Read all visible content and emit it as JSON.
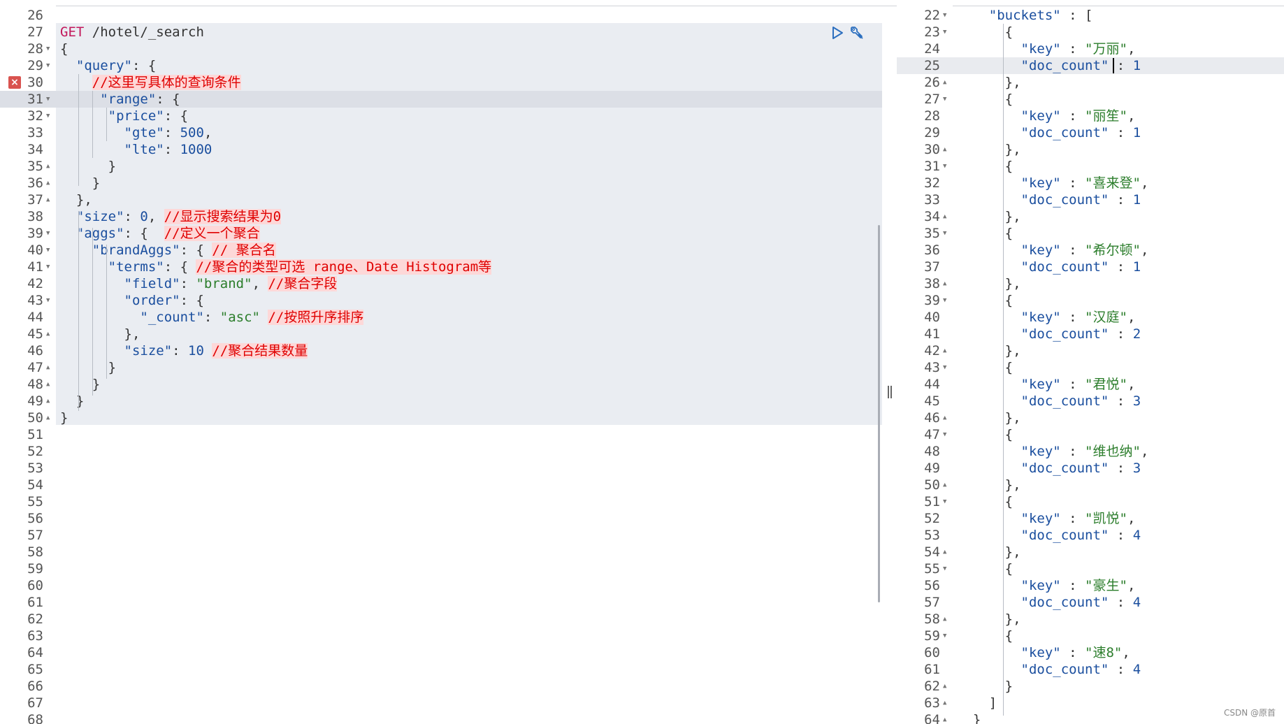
{
  "request_pane": {
    "error_line": "30",
    "lines": [
      {
        "n": "26",
        "fold": "",
        "code": []
      },
      {
        "n": "27",
        "fold": "",
        "code": [
          [
            "m",
            "GET"
          ],
          [
            "p",
            " /hotel/_search"
          ]
        ]
      },
      {
        "n": "28",
        "fold": "▼",
        "code": [
          [
            "p",
            "{"
          ]
        ]
      },
      {
        "n": "29",
        "fold": "▼",
        "code": [
          [
            "p",
            "  "
          ],
          [
            "k",
            "\"query\""
          ],
          [
            "p",
            ": {"
          ]
        ]
      },
      {
        "n": "30",
        "fold": "",
        "code": [
          [
            "p",
            "    "
          ],
          [
            "c",
            "//这里写具体的查询条件"
          ]
        ]
      },
      {
        "n": "31",
        "fold": "▼",
        "code": [
          [
            "p",
            "     "
          ],
          [
            "k",
            "\"range\""
          ],
          [
            "p",
            ": {"
          ]
        ]
      },
      {
        "n": "32",
        "fold": "▼",
        "code": [
          [
            "p",
            "      "
          ],
          [
            "k",
            "\"price\""
          ],
          [
            "p",
            ": {"
          ]
        ]
      },
      {
        "n": "33",
        "fold": "",
        "code": [
          [
            "p",
            "        "
          ],
          [
            "k",
            "\"gte\""
          ],
          [
            "p",
            ": "
          ],
          [
            "n",
            "500"
          ],
          [
            "p",
            ","
          ]
        ]
      },
      {
        "n": "34",
        "fold": "",
        "code": [
          [
            "p",
            "        "
          ],
          [
            "k",
            "\"lte\""
          ],
          [
            "p",
            ": "
          ],
          [
            "n",
            "1000"
          ]
        ]
      },
      {
        "n": "35",
        "fold": "▲",
        "code": [
          [
            "p",
            "      }"
          ]
        ]
      },
      {
        "n": "36",
        "fold": "▲",
        "code": [
          [
            "p",
            "    }"
          ]
        ]
      },
      {
        "n": "37",
        "fold": "▲",
        "code": [
          [
            "p",
            "  },"
          ]
        ]
      },
      {
        "n": "38",
        "fold": "",
        "code": [
          [
            "p",
            "  "
          ],
          [
            "k",
            "\"size\""
          ],
          [
            "p",
            ": "
          ],
          [
            "n",
            "0"
          ],
          [
            "p",
            ", "
          ],
          [
            "c",
            "//显示搜索结果为0"
          ]
        ]
      },
      {
        "n": "39",
        "fold": "▼",
        "code": [
          [
            "p",
            "  "
          ],
          [
            "k",
            "\"aggs\""
          ],
          [
            "p",
            ": {  "
          ],
          [
            "c",
            "//定义一个聚合"
          ]
        ]
      },
      {
        "n": "40",
        "fold": "▼",
        "code": [
          [
            "p",
            "    "
          ],
          [
            "k",
            "\"brandAggs\""
          ],
          [
            "p",
            ": { "
          ],
          [
            "c",
            "// 聚合名"
          ]
        ]
      },
      {
        "n": "41",
        "fold": "▼",
        "code": [
          [
            "p",
            "      "
          ],
          [
            "k",
            "\"terms\""
          ],
          [
            "p",
            ": { "
          ],
          [
            "c",
            "//聚合的类型可选 range、Date Histogram等"
          ]
        ]
      },
      {
        "n": "42",
        "fold": "",
        "code": [
          [
            "p",
            "        "
          ],
          [
            "k",
            "\"field\""
          ],
          [
            "p",
            ": "
          ],
          [
            "s",
            "\"brand\""
          ],
          [
            "p",
            ", "
          ],
          [
            "c",
            "//聚合字段"
          ]
        ]
      },
      {
        "n": "43",
        "fold": "▼",
        "code": [
          [
            "p",
            "        "
          ],
          [
            "k",
            "\"order\""
          ],
          [
            "p",
            ": {"
          ]
        ]
      },
      {
        "n": "44",
        "fold": "",
        "code": [
          [
            "p",
            "          "
          ],
          [
            "k",
            "\"_count\""
          ],
          [
            "p",
            ": "
          ],
          [
            "s",
            "\"asc\""
          ],
          [
            "p",
            " "
          ],
          [
            "c",
            "//按照升序排序"
          ]
        ]
      },
      {
        "n": "45",
        "fold": "▲",
        "code": [
          [
            "p",
            "        },"
          ]
        ]
      },
      {
        "n": "46",
        "fold": "",
        "code": [
          [
            "p",
            "        "
          ],
          [
            "k",
            "\"size\""
          ],
          [
            "p",
            ": "
          ],
          [
            "n",
            "10"
          ],
          [
            "p",
            " "
          ],
          [
            "c",
            "//聚合结果数量"
          ]
        ]
      },
      {
        "n": "47",
        "fold": "▲",
        "code": [
          [
            "p",
            "      }"
          ]
        ]
      },
      {
        "n": "48",
        "fold": "▲",
        "code": [
          [
            "p",
            "    }"
          ]
        ]
      },
      {
        "n": "49",
        "fold": "▲",
        "code": [
          [
            "p",
            "  }"
          ]
        ]
      },
      {
        "n": "50",
        "fold": "▲",
        "code": [
          [
            "p",
            "}"
          ]
        ]
      },
      {
        "n": "51",
        "fold": "",
        "code": []
      },
      {
        "n": "52",
        "fold": "",
        "code": []
      },
      {
        "n": "53",
        "fold": "",
        "code": []
      },
      {
        "n": "54",
        "fold": "",
        "code": []
      },
      {
        "n": "55",
        "fold": "",
        "code": []
      },
      {
        "n": "56",
        "fold": "",
        "code": []
      },
      {
        "n": "57",
        "fold": "",
        "code": []
      },
      {
        "n": "58",
        "fold": "",
        "code": []
      },
      {
        "n": "59",
        "fold": "",
        "code": []
      },
      {
        "n": "60",
        "fold": "",
        "code": []
      },
      {
        "n": "61",
        "fold": "",
        "code": []
      },
      {
        "n": "62",
        "fold": "",
        "code": []
      },
      {
        "n": "63",
        "fold": "",
        "code": []
      },
      {
        "n": "64",
        "fold": "",
        "code": []
      },
      {
        "n": "65",
        "fold": "",
        "code": []
      },
      {
        "n": "66",
        "fold": "",
        "code": []
      },
      {
        "n": "67",
        "fold": "",
        "code": []
      },
      {
        "n": "68",
        "fold": "",
        "code": []
      }
    ]
  },
  "response_pane": {
    "lines": [
      {
        "n": "22",
        "fold": "▼",
        "code": [
          [
            "p",
            "    "
          ],
          [
            "k",
            "\"buckets\""
          ],
          [
            "p",
            " : ["
          ]
        ]
      },
      {
        "n": "23",
        "fold": "▼",
        "code": [
          [
            "p",
            "      {"
          ]
        ]
      },
      {
        "n": "24",
        "fold": "",
        "code": [
          [
            "p",
            "        "
          ],
          [
            "k",
            "\"key\""
          ],
          [
            "p",
            " : "
          ],
          [
            "s",
            "\"万丽\""
          ],
          [
            "p",
            ","
          ]
        ]
      },
      {
        "n": "25",
        "fold": "",
        "code": [
          [
            "p",
            "        "
          ],
          [
            "k",
            "\"doc_count\""
          ],
          [
            "p",
            " : "
          ],
          [
            "n",
            "1"
          ]
        ]
      },
      {
        "n": "26",
        "fold": "▲",
        "code": [
          [
            "p",
            "      },"
          ]
        ]
      },
      {
        "n": "27",
        "fold": "▼",
        "code": [
          [
            "p",
            "      {"
          ]
        ]
      },
      {
        "n": "28",
        "fold": "",
        "code": [
          [
            "p",
            "        "
          ],
          [
            "k",
            "\"key\""
          ],
          [
            "p",
            " : "
          ],
          [
            "s",
            "\"丽笙\""
          ],
          [
            "p",
            ","
          ]
        ]
      },
      {
        "n": "29",
        "fold": "",
        "code": [
          [
            "p",
            "        "
          ],
          [
            "k",
            "\"doc_count\""
          ],
          [
            "p",
            " : "
          ],
          [
            "n",
            "1"
          ]
        ]
      },
      {
        "n": "30",
        "fold": "▲",
        "code": [
          [
            "p",
            "      },"
          ]
        ]
      },
      {
        "n": "31",
        "fold": "▼",
        "code": [
          [
            "p",
            "      {"
          ]
        ]
      },
      {
        "n": "32",
        "fold": "",
        "code": [
          [
            "p",
            "        "
          ],
          [
            "k",
            "\"key\""
          ],
          [
            "p",
            " : "
          ],
          [
            "s",
            "\"喜来登\""
          ],
          [
            "p",
            ","
          ]
        ]
      },
      {
        "n": "33",
        "fold": "",
        "code": [
          [
            "p",
            "        "
          ],
          [
            "k",
            "\"doc_count\""
          ],
          [
            "p",
            " : "
          ],
          [
            "n",
            "1"
          ]
        ]
      },
      {
        "n": "34",
        "fold": "▲",
        "code": [
          [
            "p",
            "      },"
          ]
        ]
      },
      {
        "n": "35",
        "fold": "▼",
        "code": [
          [
            "p",
            "      {"
          ]
        ]
      },
      {
        "n": "36",
        "fold": "",
        "code": [
          [
            "p",
            "        "
          ],
          [
            "k",
            "\"key\""
          ],
          [
            "p",
            " : "
          ],
          [
            "s",
            "\"希尔顿\""
          ],
          [
            "p",
            ","
          ]
        ]
      },
      {
        "n": "37",
        "fold": "",
        "code": [
          [
            "p",
            "        "
          ],
          [
            "k",
            "\"doc_count\""
          ],
          [
            "p",
            " : "
          ],
          [
            "n",
            "1"
          ]
        ]
      },
      {
        "n": "38",
        "fold": "▲",
        "code": [
          [
            "p",
            "      },"
          ]
        ]
      },
      {
        "n": "39",
        "fold": "▼",
        "code": [
          [
            "p",
            "      {"
          ]
        ]
      },
      {
        "n": "40",
        "fold": "",
        "code": [
          [
            "p",
            "        "
          ],
          [
            "k",
            "\"key\""
          ],
          [
            "p",
            " : "
          ],
          [
            "s",
            "\"汉庭\""
          ],
          [
            "p",
            ","
          ]
        ]
      },
      {
        "n": "41",
        "fold": "",
        "code": [
          [
            "p",
            "        "
          ],
          [
            "k",
            "\"doc_count\""
          ],
          [
            "p",
            " : "
          ],
          [
            "n",
            "2"
          ]
        ]
      },
      {
        "n": "42",
        "fold": "▲",
        "code": [
          [
            "p",
            "      },"
          ]
        ]
      },
      {
        "n": "43",
        "fold": "▼",
        "code": [
          [
            "p",
            "      {"
          ]
        ]
      },
      {
        "n": "44",
        "fold": "",
        "code": [
          [
            "p",
            "        "
          ],
          [
            "k",
            "\"key\""
          ],
          [
            "p",
            " : "
          ],
          [
            "s",
            "\"君悦\""
          ],
          [
            "p",
            ","
          ]
        ]
      },
      {
        "n": "45",
        "fold": "",
        "code": [
          [
            "p",
            "        "
          ],
          [
            "k",
            "\"doc_count\""
          ],
          [
            "p",
            " : "
          ],
          [
            "n",
            "3"
          ]
        ]
      },
      {
        "n": "46",
        "fold": "▲",
        "code": [
          [
            "p",
            "      },"
          ]
        ]
      },
      {
        "n": "47",
        "fold": "▼",
        "code": [
          [
            "p",
            "      {"
          ]
        ]
      },
      {
        "n": "48",
        "fold": "",
        "code": [
          [
            "p",
            "        "
          ],
          [
            "k",
            "\"key\""
          ],
          [
            "p",
            " : "
          ],
          [
            "s",
            "\"维也纳\""
          ],
          [
            "p",
            ","
          ]
        ]
      },
      {
        "n": "49",
        "fold": "",
        "code": [
          [
            "p",
            "        "
          ],
          [
            "k",
            "\"doc_count\""
          ],
          [
            "p",
            " : "
          ],
          [
            "n",
            "3"
          ]
        ]
      },
      {
        "n": "50",
        "fold": "▲",
        "code": [
          [
            "p",
            "      },"
          ]
        ]
      },
      {
        "n": "51",
        "fold": "▼",
        "code": [
          [
            "p",
            "      {"
          ]
        ]
      },
      {
        "n": "52",
        "fold": "",
        "code": [
          [
            "p",
            "        "
          ],
          [
            "k",
            "\"key\""
          ],
          [
            "p",
            " : "
          ],
          [
            "s",
            "\"凯悦\""
          ],
          [
            "p",
            ","
          ]
        ]
      },
      {
        "n": "53",
        "fold": "",
        "code": [
          [
            "p",
            "        "
          ],
          [
            "k",
            "\"doc_count\""
          ],
          [
            "p",
            " : "
          ],
          [
            "n",
            "4"
          ]
        ]
      },
      {
        "n": "54",
        "fold": "▲",
        "code": [
          [
            "p",
            "      },"
          ]
        ]
      },
      {
        "n": "55",
        "fold": "▼",
        "code": [
          [
            "p",
            "      {"
          ]
        ]
      },
      {
        "n": "56",
        "fold": "",
        "code": [
          [
            "p",
            "        "
          ],
          [
            "k",
            "\"key\""
          ],
          [
            "p",
            " : "
          ],
          [
            "s",
            "\"豪生\""
          ],
          [
            "p",
            ","
          ]
        ]
      },
      {
        "n": "57",
        "fold": "",
        "code": [
          [
            "p",
            "        "
          ],
          [
            "k",
            "\"doc_count\""
          ],
          [
            "p",
            " : "
          ],
          [
            "n",
            "4"
          ]
        ]
      },
      {
        "n": "58",
        "fold": "▲",
        "code": [
          [
            "p",
            "      },"
          ]
        ]
      },
      {
        "n": "59",
        "fold": "▼",
        "code": [
          [
            "p",
            "      {"
          ]
        ]
      },
      {
        "n": "60",
        "fold": "",
        "code": [
          [
            "p",
            "        "
          ],
          [
            "k",
            "\"key\""
          ],
          [
            "p",
            " : "
          ],
          [
            "s",
            "\"速8\""
          ],
          [
            "p",
            ","
          ]
        ]
      },
      {
        "n": "61",
        "fold": "",
        "code": [
          [
            "p",
            "        "
          ],
          [
            "k",
            "\"doc_count\""
          ],
          [
            "p",
            " : "
          ],
          [
            "n",
            "4"
          ]
        ]
      },
      {
        "n": "62",
        "fold": "▲",
        "code": [
          [
            "p",
            "      }"
          ]
        ]
      },
      {
        "n": "63",
        "fold": "▲",
        "code": [
          [
            "p",
            "    ]"
          ]
        ]
      },
      {
        "n": "64",
        "fold": "▲",
        "code": [
          [
            "p",
            "  }"
          ]
        ]
      }
    ]
  },
  "icons": {
    "run": "play-icon",
    "settings": "wrench-icon",
    "error": "error-icon"
  },
  "watermark": "CSDN @原首"
}
